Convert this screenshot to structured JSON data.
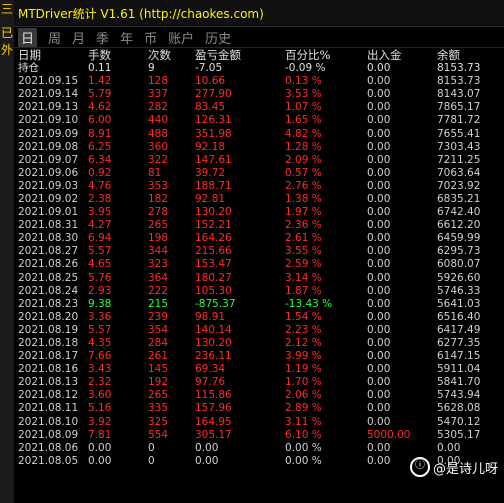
{
  "side_labels": [
    "三",
    "已",
    "外"
  ],
  "title": "MTDriver统计 V1.61  (http://chaokes.com)",
  "tabs": [
    "日",
    "周",
    "月",
    "季",
    "年",
    "币",
    "账户",
    "历史"
  ],
  "active_tab": "日",
  "headers": {
    "date": "日期",
    "lots": "手数",
    "count": "次数",
    "pnl": "盈亏金额",
    "pct": "百分比%",
    "io": "出入金",
    "balance": "余额"
  },
  "holding": {
    "date": "持仓",
    "lots": "0.11",
    "count": "9",
    "pnl": "-7.05",
    "pct": "-0.09 %",
    "io": "0.00",
    "balance": "8153.73"
  },
  "rows": [
    {
      "date": "2021.09.15",
      "lots": "1.42",
      "count": "128",
      "pnl": "10.66",
      "pct": "0.13 %",
      "io": "0.00",
      "balance": "8153.73",
      "color": "red"
    },
    {
      "date": "2021.09.14",
      "lots": "5.79",
      "count": "337",
      "pnl": "277.90",
      "pct": "3.53 %",
      "io": "0.00",
      "balance": "8143.07",
      "color": "red"
    },
    {
      "date": "2021.09.13",
      "lots": "4.62",
      "count": "282",
      "pnl": "83.45",
      "pct": "1.07 %",
      "io": "0.00",
      "balance": "7865.17",
      "color": "red"
    },
    {
      "date": "2021.09.10",
      "lots": "6.00",
      "count": "440",
      "pnl": "126.31",
      "pct": "1.65 %",
      "io": "0.00",
      "balance": "7781.72",
      "color": "red"
    },
    {
      "date": "2021.09.09",
      "lots": "8.91",
      "count": "488",
      "pnl": "351.98",
      "pct": "4.82 %",
      "io": "0.00",
      "balance": "7655.41",
      "color": "red"
    },
    {
      "date": "2021.09.08",
      "lots": "6.25",
      "count": "360",
      "pnl": "92.18",
      "pct": "1.28 %",
      "io": "0.00",
      "balance": "7303.43",
      "color": "red"
    },
    {
      "date": "2021.09.07",
      "lots": "6.34",
      "count": "322",
      "pnl": "147.61",
      "pct": "2.09 %",
      "io": "0.00",
      "balance": "7211.25",
      "color": "red"
    },
    {
      "date": "2021.09.06",
      "lots": "0.92",
      "count": "81",
      "pnl": "39.72",
      "pct": "0.57 %",
      "io": "0.00",
      "balance": "7063.64",
      "color": "red"
    },
    {
      "date": "2021.09.03",
      "lots": "4.76",
      "count": "353",
      "pnl": "188.71",
      "pct": "2.76 %",
      "io": "0.00",
      "balance": "7023.92",
      "color": "red"
    },
    {
      "date": "2021.09.02",
      "lots": "2.38",
      "count": "182",
      "pnl": "92.81",
      "pct": "1.38 %",
      "io": "0.00",
      "balance": "6835.21",
      "color": "red"
    },
    {
      "date": "2021.09.01",
      "lots": "3.95",
      "count": "278",
      "pnl": "130.20",
      "pct": "1.97 %",
      "io": "0.00",
      "balance": "6742.40",
      "color": "red"
    },
    {
      "date": "2021.08.31",
      "lots": "4.27",
      "count": "265",
      "pnl": "152.21",
      "pct": "2.36 %",
      "io": "0.00",
      "balance": "6612.20",
      "color": "red"
    },
    {
      "date": "2021.08.30",
      "lots": "6.94",
      "count": "198",
      "pnl": "164.26",
      "pct": "2.61 %",
      "io": "0.00",
      "balance": "6459.99",
      "color": "red"
    },
    {
      "date": "2021.08.27",
      "lots": "5.57",
      "count": "344",
      "pnl": "215.66",
      "pct": "3.55 %",
      "io": "0.00",
      "balance": "6295.73",
      "color": "red"
    },
    {
      "date": "2021.08.26",
      "lots": "4.65",
      "count": "323",
      "pnl": "153.47",
      "pct": "2.59 %",
      "io": "0.00",
      "balance": "6080.07",
      "color": "red"
    },
    {
      "date": "2021.08.25",
      "lots": "5.76",
      "count": "364",
      "pnl": "180.27",
      "pct": "3.14 %",
      "io": "0.00",
      "balance": "5926.60",
      "color": "red"
    },
    {
      "date": "2021.08.24",
      "lots": "2.93",
      "count": "222",
      "pnl": "105.30",
      "pct": "1.87 %",
      "io": "0.00",
      "balance": "5746.33",
      "color": "red"
    },
    {
      "date": "2021.08.23",
      "lots": "9.38",
      "count": "215",
      "pnl": "-875.37",
      "pct": "-13.43 %",
      "io": "0.00",
      "balance": "5641.03",
      "color": "green"
    },
    {
      "date": "2021.08.20",
      "lots": "3.36",
      "count": "239",
      "pnl": "98.91",
      "pct": "1.54 %",
      "io": "0.00",
      "balance": "6516.40",
      "color": "red"
    },
    {
      "date": "2021.08.19",
      "lots": "5.57",
      "count": "354",
      "pnl": "140.14",
      "pct": "2.23 %",
      "io": "0.00",
      "balance": "6417.49",
      "color": "red"
    },
    {
      "date": "2021.08.18",
      "lots": "4.35",
      "count": "284",
      "pnl": "130.20",
      "pct": "2.12 %",
      "io": "0.00",
      "balance": "6277.35",
      "color": "red"
    },
    {
      "date": "2021.08.17",
      "lots": "7.66",
      "count": "261",
      "pnl": "236.11",
      "pct": "3.99 %",
      "io": "0.00",
      "balance": "6147.15",
      "color": "red"
    },
    {
      "date": "2021.08.16",
      "lots": "3.43",
      "count": "145",
      "pnl": "69.34",
      "pct": "1.19 %",
      "io": "0.00",
      "balance": "5911.04",
      "color": "red"
    },
    {
      "date": "2021.08.13",
      "lots": "2.32",
      "count": "192",
      "pnl": "97.76",
      "pct": "1.70 %",
      "io": "0.00",
      "balance": "5841.70",
      "color": "red"
    },
    {
      "date": "2021.08.12",
      "lots": "3.60",
      "count": "265",
      "pnl": "115.86",
      "pct": "2.06 %",
      "io": "0.00",
      "balance": "5743.94",
      "color": "red"
    },
    {
      "date": "2021.08.11",
      "lots": "5.16",
      "count": "335",
      "pnl": "157.96",
      "pct": "2.89 %",
      "io": "0.00",
      "balance": "5628.08",
      "color": "red"
    },
    {
      "date": "2021.08.10",
      "lots": "3.92",
      "count": "325",
      "pnl": "164.95",
      "pct": "3.11 %",
      "io": "0.00",
      "balance": "5470.12",
      "color": "red"
    },
    {
      "date": "2021.08.09",
      "lots": "7.81",
      "count": "554",
      "pnl": "305.17",
      "pct": "6.10 %",
      "io": "5000.00",
      "balance": "5305.17",
      "color": "red"
    },
    {
      "date": "2021.08.06",
      "lots": "0.00",
      "count": "0",
      "pnl": "0.00",
      "pct": "0.00 %",
      "io": "0.00",
      "balance": "0.00",
      "color": "white"
    },
    {
      "date": "2021.08.05",
      "lots": "0.00",
      "count": "0",
      "pnl": "0.00",
      "pct": "0.00 %",
      "io": "0.00",
      "balance": "0.00",
      "color": "white"
    }
  ],
  "watermark": "@是诗儿呀",
  "colors": {
    "positive": "#ff2a2a",
    "negative": "#2dff2d",
    "title": "#fff200"
  }
}
